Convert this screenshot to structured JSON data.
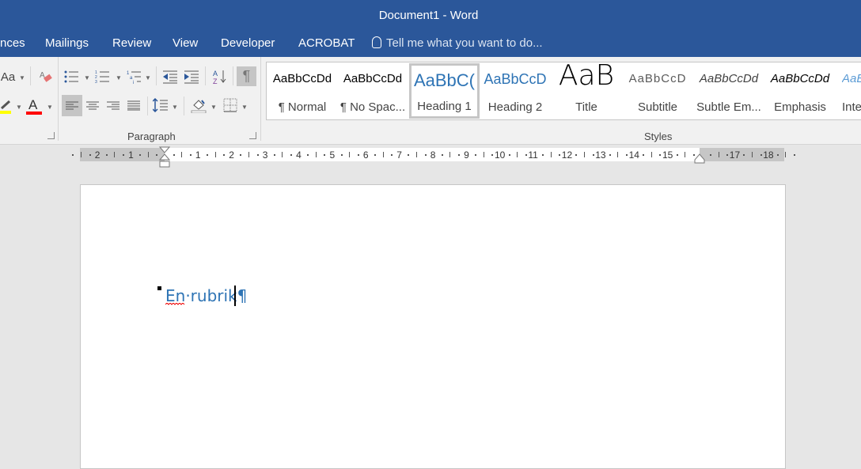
{
  "window": {
    "title": "Document1 - Word"
  },
  "tabs": [
    {
      "label": "nces"
    },
    {
      "label": "Mailings"
    },
    {
      "label": "Review"
    },
    {
      "label": "View"
    },
    {
      "label": "Developer"
    },
    {
      "label": "ACROBAT"
    }
  ],
  "tellme": {
    "placeholder": "Tell me what you want to do..."
  },
  "ribbon": {
    "font_group": {
      "change_case": "Aa",
      "font_color_letter": "A",
      "highlight_color": "#ffff00",
      "font_color": "#ff0000"
    },
    "paragraph_group": {
      "label": "Paragraph",
      "show_marks": "¶",
      "sort_label": "AZ"
    },
    "styles_group": {
      "label": "Styles"
    }
  },
  "styles": [
    {
      "preview": "AaBbCcDd",
      "name": "¶ Normal"
    },
    {
      "preview": "AaBbCcDd",
      "name": "¶ No Spac..."
    },
    {
      "preview": "AaBbC(",
      "name": "Heading 1",
      "selected": true
    },
    {
      "preview": "AaBbCcD",
      "name": "Heading 2"
    },
    {
      "preview": "AaB",
      "name": "Title"
    },
    {
      "preview": "AaBbCcD",
      "name": "Subtitle"
    },
    {
      "preview": "AaBbCcDd",
      "name": "Subtle Em..."
    },
    {
      "preview": "AaBbCcDd",
      "name": "Emphasis"
    },
    {
      "preview": "AaB",
      "name": "Inte"
    }
  ],
  "ruler": {
    "left_numbers": [
      "2",
      "1"
    ],
    "numbers": [
      "1",
      "2",
      "3",
      "4",
      "5",
      "6",
      "7",
      "8",
      "9",
      "10",
      "11",
      "12",
      "13",
      "14",
      "15"
    ],
    "right_numbers": [
      "17",
      "18"
    ]
  },
  "document": {
    "text": "En·rubrik",
    "pilcrow": "¶",
    "heading_color": "#2e74b5"
  },
  "colors": {
    "accent": "#2b579a"
  }
}
